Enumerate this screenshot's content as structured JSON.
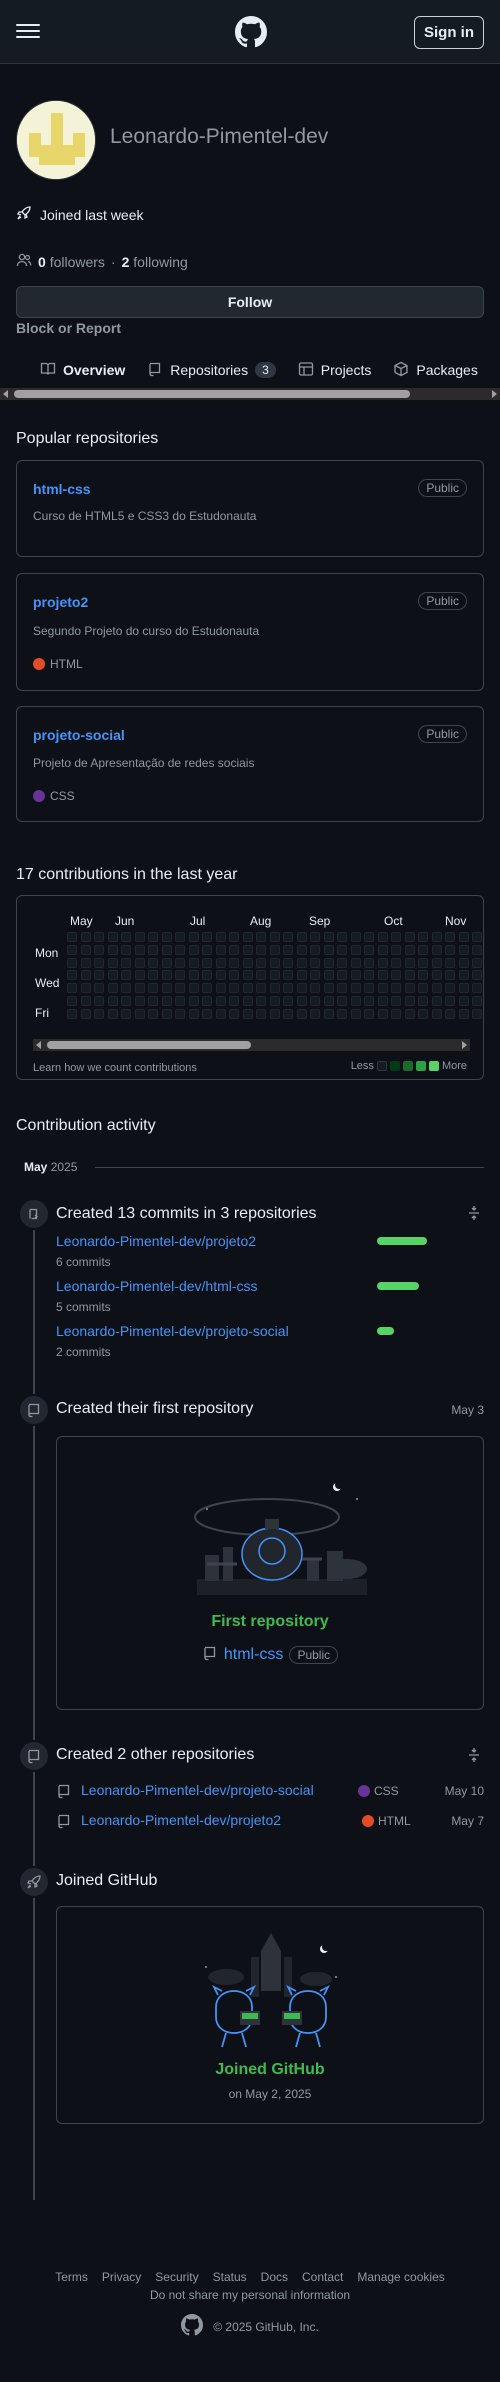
{
  "header": {
    "sign_in": "Sign in"
  },
  "profile": {
    "username": "Leonardo-Pimentel-dev",
    "joined": "Joined last week",
    "followers_count": "0",
    "followers_label": "followers",
    "sep": "·",
    "following_count": "2",
    "following_label": "following",
    "follow_button": "Follow",
    "block_report": "Block or Report"
  },
  "tabs": [
    {
      "label": "Overview",
      "icon": "book-icon"
    },
    {
      "label": "Repositories",
      "icon": "repo-icon",
      "count": "3"
    },
    {
      "label": "Projects",
      "icon": "table-icon"
    },
    {
      "label": "Packages",
      "icon": "package-icon"
    }
  ],
  "popular": {
    "title": "Popular repositories",
    "repos": [
      {
        "name": "html-css",
        "visibility": "Public",
        "desc": "Curso de HTML5 e CSS3 do Estudonauta",
        "lang": "",
        "lang_color": ""
      },
      {
        "name": "projeto2",
        "visibility": "Public",
        "desc": "Segundo Projeto do curso do Estudonauta",
        "lang": "HTML",
        "lang_color": "#e34c26"
      },
      {
        "name": "projeto-social",
        "visibility": "Public",
        "desc": "Projeto de Apresentação de redes sociais",
        "lang": "CSS",
        "lang_color": "#663399"
      }
    ]
  },
  "contributions": {
    "title": "17 contributions in the last year",
    "months": [
      "May",
      "Jun",
      "Jul",
      "Aug",
      "Sep",
      "Oct",
      "Nov"
    ],
    "days": [
      "Mon",
      "Wed",
      "Fri"
    ],
    "learn": "Learn how we count contributions",
    "less": "Less",
    "more": "More",
    "legend_colors": [
      "#151b23",
      "#033a16",
      "#196c2e",
      "#2ea043",
      "#56d364"
    ]
  },
  "activity": {
    "title": "Contribution activity",
    "month": "May",
    "year": "2025",
    "commits": {
      "title": "Created 13 commits in 3 repositories",
      "items": [
        {
          "repo": "Leonardo-Pimentel-dev/projeto2",
          "count": "6 commits",
          "share": 1.0
        },
        {
          "repo": "Leonardo-Pimentel-dev/html-css",
          "count": "5 commits",
          "share": 0.83
        },
        {
          "repo": "Leonardo-Pimentel-dev/projeto-social",
          "count": "2 commits",
          "share": 0.33
        }
      ]
    },
    "first_repo": {
      "title": "Created their first repository",
      "date": "May 3",
      "label": "First repository",
      "repo": "html-css",
      "visibility": "Public"
    },
    "other_repos": {
      "title": "Created 2 other repositories",
      "items": [
        {
          "repo": "Leonardo-Pimentel-dev/projeto-social",
          "lang": "CSS",
          "lang_color": "#663399",
          "date": "May 10"
        },
        {
          "repo": "Leonardo-Pimentel-dev/projeto2",
          "lang": "HTML",
          "lang_color": "#e34c26",
          "date": "May 7"
        }
      ]
    },
    "joined": {
      "title": "Joined GitHub",
      "label": "Joined GitHub",
      "date": "on May 2, 2025"
    }
  },
  "footer": {
    "links": [
      "Terms",
      "Privacy",
      "Security",
      "Status",
      "Docs",
      "Contact",
      "Manage cookies"
    ],
    "privacy": "Do not share my personal information",
    "copyright": "© 2025 GitHub, Inc."
  }
}
